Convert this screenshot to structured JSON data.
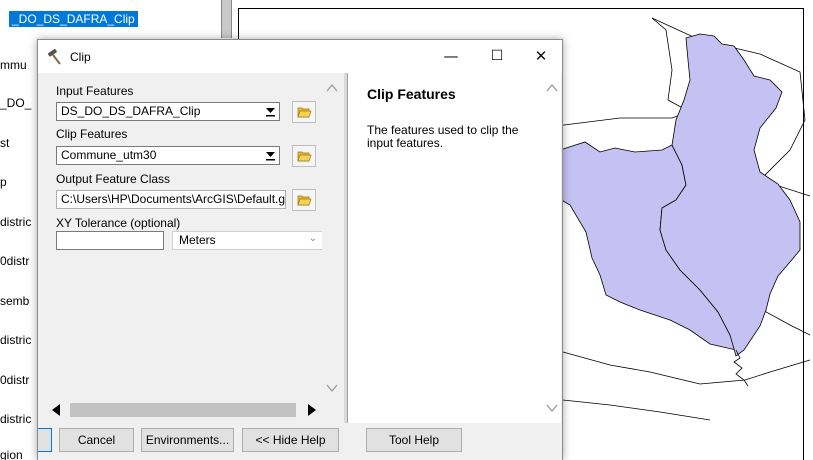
{
  "toc": {
    "selected_layer": "_DO_DS_DAFRA_Clip",
    "items": [
      "mmu",
      "_DO_",
      "st",
      "p",
      "distric",
      "0distr",
      "semb",
      "distric",
      "0distr",
      "distric",
      "gion"
    ]
  },
  "map": {
    "selected_fill": "#c5c1f2",
    "outline_color": "#000000"
  },
  "dialog": {
    "title": "Clip",
    "window_controls": {
      "minimize": "—",
      "maximize": "☐",
      "close": "✕"
    },
    "fields": {
      "input_features_label": "Input Features",
      "input_features_value": "DS_DO_DS_DAFRA_Clip",
      "clip_features_label": "Clip Features",
      "clip_features_value": "Commune_utm30",
      "output_class_label": "Output Feature Class",
      "output_class_value": "C:\\Users\\HP\\Documents\\ArcGIS\\Default.gdb\\",
      "xy_tolerance_label": "XY Tolerance (optional)",
      "xy_tolerance_value": "",
      "xy_units": "Meters"
    },
    "help": {
      "title": "Clip Features",
      "text": "The features used to clip the input features."
    },
    "buttons": {
      "cancel": "Cancel",
      "environments": "Environments...",
      "hide_help": "<< Hide Help",
      "tool_help": "Tool Help"
    }
  },
  "icons": {
    "title": "hammer-icon",
    "browse": "folder-open-icon",
    "dropdown": "dropdown-arrow-icon"
  }
}
